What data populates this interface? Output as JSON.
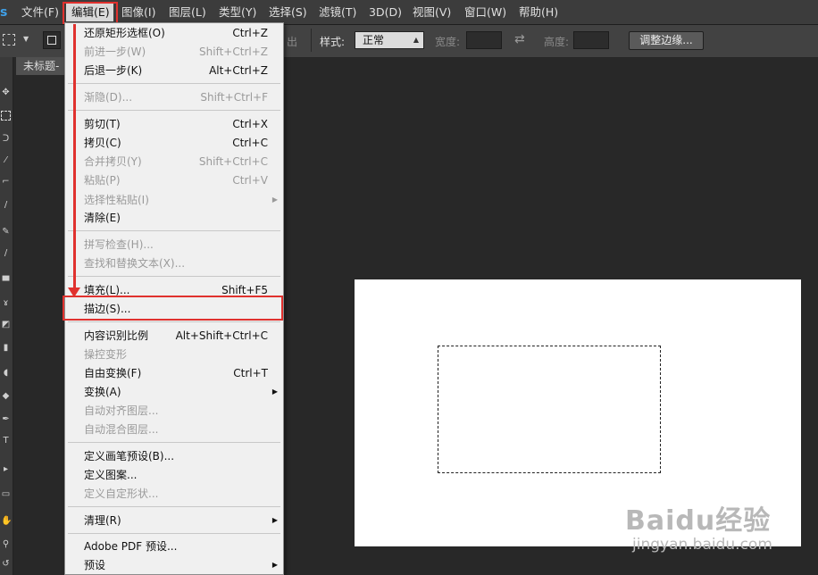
{
  "menubar": {
    "logo": "s",
    "items": [
      "文件(F)",
      "编辑(E)",
      "图像(I)",
      "图层(L)",
      "类型(Y)",
      "选择(S)",
      "滤镜(T)",
      "3D(D)",
      "视图(V)",
      "窗口(W)",
      "帮助(H)"
    ],
    "active": "编辑(E)"
  },
  "options": {
    "partial_label": "出",
    "style_label": "样式:",
    "style_value": "正常",
    "width_label": "宽度:",
    "height_label": "高度:",
    "refine_button": "调整边缘..."
  },
  "document": {
    "tab_title": "未标题-"
  },
  "edit_menu": {
    "items": [
      {
        "label": "还原矩形选框(O)",
        "shortcut": "Ctrl+Z",
        "enabled": true
      },
      {
        "label": "前进一步(W)",
        "shortcut": "Shift+Ctrl+Z",
        "enabled": false
      },
      {
        "label": "后退一步(K)",
        "shortcut": "Alt+Ctrl+Z",
        "enabled": true
      },
      {
        "label": "渐隐(D)...",
        "shortcut": "Shift+Ctrl+F",
        "enabled": false
      },
      {
        "label": "剪切(T)",
        "shortcut": "Ctrl+X",
        "enabled": true
      },
      {
        "label": "拷贝(C)",
        "shortcut": "Ctrl+C",
        "enabled": true
      },
      {
        "label": "合并拷贝(Y)",
        "shortcut": "Shift+Ctrl+C",
        "enabled": false
      },
      {
        "label": "粘贴(P)",
        "shortcut": "Ctrl+V",
        "enabled": false
      },
      {
        "label": "选择性粘贴(I)",
        "shortcut": "",
        "enabled": false,
        "submenu": true
      },
      {
        "label": "清除(E)",
        "shortcut": "",
        "enabled": true
      },
      {
        "label": "拼写检查(H)...",
        "shortcut": "",
        "enabled": false
      },
      {
        "label": "查找和替换文本(X)...",
        "shortcut": "",
        "enabled": false
      },
      {
        "label": "填充(L)...",
        "shortcut": "Shift+F5",
        "enabled": true
      },
      {
        "label": "描边(S)...",
        "shortcut": "",
        "enabled": true,
        "highlighted": true
      },
      {
        "label": "内容识别比例",
        "shortcut": "Alt+Shift+Ctrl+C",
        "enabled": true
      },
      {
        "label": "操控变形",
        "shortcut": "",
        "enabled": false
      },
      {
        "label": "自由变换(F)",
        "shortcut": "Ctrl+T",
        "enabled": true
      },
      {
        "label": "变换(A)",
        "shortcut": "",
        "enabled": true,
        "submenu": true
      },
      {
        "label": "自动对齐图层...",
        "shortcut": "",
        "enabled": false
      },
      {
        "label": "自动混合图层...",
        "shortcut": "",
        "enabled": false
      },
      {
        "label": "定义画笔预设(B)...",
        "shortcut": "",
        "enabled": true
      },
      {
        "label": "定义图案...",
        "shortcut": "",
        "enabled": true
      },
      {
        "label": "定义自定形状...",
        "shortcut": "",
        "enabled": false
      },
      {
        "label": "清理(R)",
        "shortcut": "",
        "enabled": true,
        "submenu": true
      },
      {
        "label": "Adobe PDF 预设...",
        "shortcut": "",
        "enabled": true
      },
      {
        "label": "预设",
        "shortcut": "",
        "enabled": true,
        "submenu": true
      }
    ]
  },
  "watermark": {
    "text": "Baidu经验",
    "url": "jingyan.baidu.com"
  },
  "colors": {
    "highlight": "#e0312e",
    "app_bg": "#282828",
    "menu_bg": "#f0f0f0"
  }
}
